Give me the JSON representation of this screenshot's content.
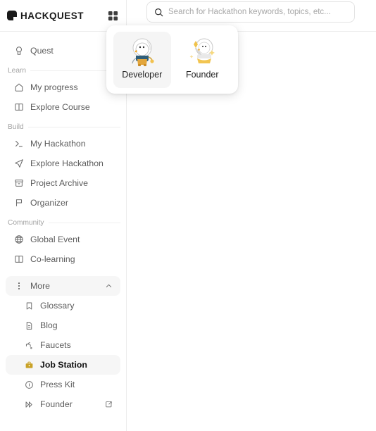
{
  "header": {
    "logo_text": "HACKQUEST",
    "grid_icon": "grid-apps-icon",
    "search": {
      "placeholder": "Search for Hackathon keywords, topics, etc...",
      "value": "",
      "icon": "search-icon"
    }
  },
  "role_popup": {
    "options": [
      {
        "label": "Developer",
        "icon": "duck-astronaut-developer-illustration",
        "selected": true
      },
      {
        "label": "Founder",
        "icon": "duck-astronaut-founder-illustration",
        "selected": false
      }
    ]
  },
  "sidebar": {
    "top_items": [
      {
        "label": "Quest",
        "icon": "medal-icon"
      }
    ],
    "sections": [
      {
        "label": "Learn",
        "items": [
          {
            "label": "My progress",
            "icon": "home-icon"
          },
          {
            "label": "Explore Course",
            "icon": "book-open-icon"
          }
        ]
      },
      {
        "label": "Build",
        "items": [
          {
            "label": "My Hackathon",
            "icon": "terminal-icon"
          },
          {
            "label": "Explore Hackathon",
            "icon": "paper-plane-icon"
          },
          {
            "label": "Project Archive",
            "icon": "archive-box-icon"
          },
          {
            "label": "Organizer",
            "icon": "flag-icon"
          }
        ]
      },
      {
        "label": "Community",
        "items": [
          {
            "label": "Global Event",
            "icon": "globe-icon"
          },
          {
            "label": "Co-learning",
            "icon": "book-open-icon"
          }
        ]
      }
    ],
    "more": {
      "label": "More",
      "icon": "dots-vertical-icon",
      "chevron": "chevron-up-icon",
      "expanded": true,
      "children": [
        {
          "label": "Glossary",
          "icon": "bookmark-icon",
          "current": false
        },
        {
          "label": "Blog",
          "icon": "document-icon",
          "current": false
        },
        {
          "label": "Faucets",
          "icon": "faucet-icon",
          "current": false
        },
        {
          "label": "Job Station",
          "icon": "briefcase-icon",
          "current": true
        },
        {
          "label": "Press Kit",
          "icon": "info-circle-icon",
          "current": false
        },
        {
          "label": "Founder",
          "icon": "double-arrow-icon",
          "current": false,
          "external_icon": "external-link-icon"
        }
      ]
    }
  },
  "colors": {
    "accent_gold": "#c9a227",
    "text_primary": "#111111",
    "text_muted": "#5c5c5c",
    "section_label": "#a3a3a3",
    "border": "#ececec",
    "selected_bg": "#f5f5f5"
  }
}
